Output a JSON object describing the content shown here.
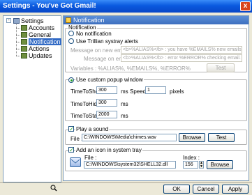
{
  "window": {
    "title": "Settings - You've Got Gmail!",
    "close_glyph": "x"
  },
  "tree": {
    "root_label": "Settings",
    "items": [
      {
        "label": "Accounts"
      },
      {
        "label": "General"
      },
      {
        "label": "Notification"
      },
      {
        "label": "Actions"
      },
      {
        "label": "Updates"
      }
    ],
    "selected": "Notification"
  },
  "panel": {
    "title": "Notification",
    "notification_group": {
      "title": "Notification",
      "no_notification": "No notification",
      "use_trillian": "Use Trillian systray alerts",
      "msg_new_email_label": "Message on new email(s) :",
      "msg_new_email_value": "<b>%ALIAS%</b> : you have %EMAILS% new emails.",
      "msg_error_label": "Message on error :",
      "msg_error_value": "<b>%ALIAS%</b> : error %ERROR% checking email.",
      "variables_text": "Variables : %ALIAS%, %EMAILS%, %ERROR%",
      "test_label": "Test"
    },
    "popup": {
      "use_custom_label": "Use custom popup window",
      "time_to_show_label": "TimeToShow :",
      "time_to_show_value": "300",
      "time_to_show_unit": "ms",
      "speed_label": "Speed :",
      "speed_value": "1",
      "speed_unit": "pixels",
      "time_to_hide_label": "TimeToHide :",
      "time_to_hide_value": "300",
      "time_to_hide_unit": "ms",
      "time_to_stay_label": "TimeToStay :",
      "time_to_stay_value": "2000",
      "time_to_stay_unit": "ms"
    },
    "sound": {
      "play_label": "Play a sound",
      "file_label": "File :",
      "file_value": "C:\\WINDOWS\\Media\\chimes.wav",
      "browse_label": "Browse",
      "test_label": "Test"
    },
    "tray": {
      "add_icon_label": "Add an icon in system tray",
      "file_label": "File :",
      "file_value": "C:\\WINDOWS\\system32\\SHELL32.dll",
      "index_label": "Index :",
      "index_value": "156",
      "browse_label": "Browse"
    }
  },
  "footer": {
    "ok_label": "OK",
    "cancel_label": "Cancel",
    "apply_label": "Apply"
  }
}
